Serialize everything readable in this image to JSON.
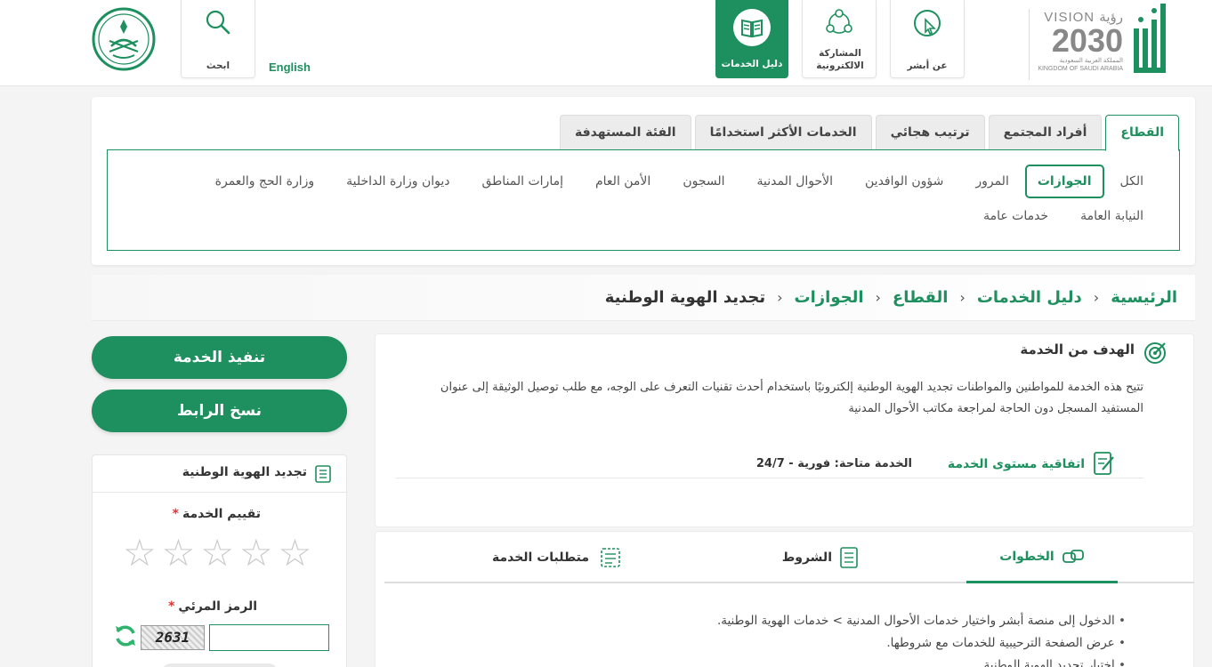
{
  "header": {
    "brand": "أبشر",
    "vision": {
      "top": "VISION رؤية",
      "number": "2030",
      "sub1": "المملكة العربية السعودية",
      "sub2": "KINGDOM OF SAUDI ARABIA"
    },
    "nav": [
      {
        "label": "عن أبشر",
        "icon": "cursor-click-icon"
      },
      {
        "label": "المشاركة الالكترونية",
        "icon": "network-people-icon"
      },
      {
        "label": "دليل الخدمات",
        "icon": "open-book-icon",
        "active": true
      }
    ],
    "search_label": "ابحث",
    "language_link": "English"
  },
  "filter": {
    "tabs": [
      "القطاع",
      "أفراد المجتمع",
      "ترتيب هجائي",
      "الخدمات الأكثر استخدامًا",
      "الفئة المستهدفة"
    ],
    "active_tab": "القطاع",
    "row1": [
      "الكل",
      "الجوازات",
      "المرور",
      "شؤون الوافدين",
      "الأحوال المدنية",
      "السجون",
      "الأمن العام",
      "إمارات المناطق",
      "ديوان وزارة الداخلية",
      "وزارة الحج والعمرة"
    ],
    "row2": [
      "النيابة العامة",
      "خدمات عامة"
    ],
    "active_sector": "الجوازات"
  },
  "breadcrumb": [
    "الرئيسية",
    "دليل الخدمات",
    "القطاع",
    "الجوازات",
    "تجديد الهوية الوطنية"
  ],
  "goal": {
    "title": "الهدف من الخدمة",
    "text": "تتيح هذه الخدمة للمواطنين والمواطنات تجديد الهوية الوطنية إلكترونيًا باستخدام أحدث تقنيات التعرف على الوجه، مع طلب توصيل الوثيقة إلى عنوان المستفيد المسجل دون الحاجة لمراجعة مكاتب الأحوال المدنية",
    "sla_label": "اتفاقية مستوى الخدمة",
    "sla_value": "الخدمة متاحة: فورية - 24/7"
  },
  "steps": {
    "tabs": [
      "الخطوات",
      "الشروط",
      "متطلبات الخدمة"
    ],
    "active_tab": "الخطوات",
    "items": [
      "الدخول إلى منصة أبشر واختيار خدمات الأحوال المدنية > خدمات الهوية الوطنية.",
      "عرض الصفحة الترحيبية للخدمات مع شروطها.",
      "اختيار تجديد الهوية الوطنية"
    ]
  },
  "sidebar": {
    "execute_button": "تنفيذ الخدمة",
    "copy_link_button": "نسخ الرابط",
    "card_title": "تجديد الهوية الوطنية",
    "rating_label": "تقييم الخدمة",
    "required_mark": "*",
    "stars_total": 5,
    "captcha_label": "الرمز المرئي",
    "captcha_text": "2631"
  },
  "colors": {
    "brand_green": "#1e8f5e",
    "star_empty": "#c9c9c9",
    "required_red": "#d33333"
  }
}
